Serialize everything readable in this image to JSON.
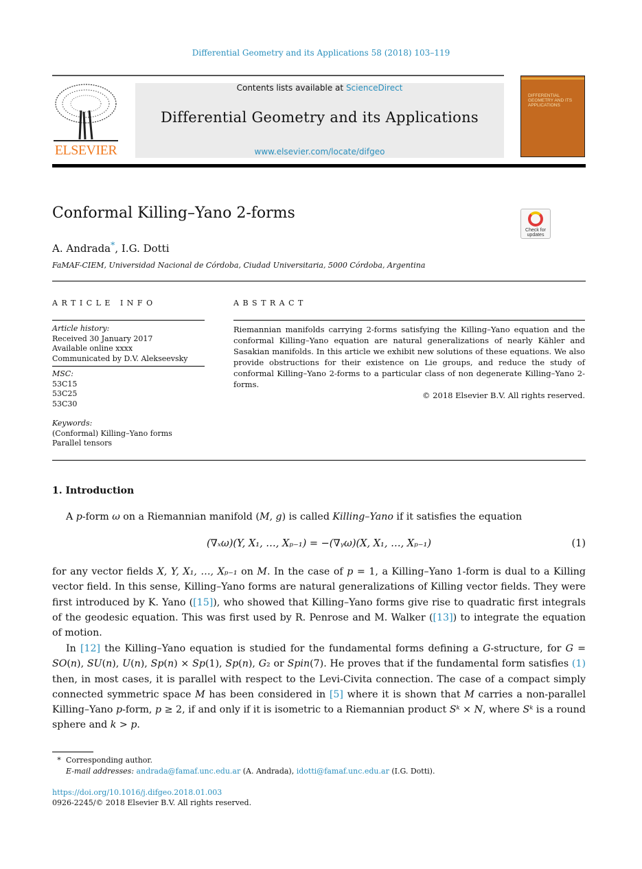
{
  "header": {
    "journal_ref": "Differential Geometry and its Applications 58 (2018) 103–119",
    "contents_prefix": "Contents lists available at ",
    "sciencedirect": "ScienceDirect",
    "journal_title": "Differential Geometry and its Applications",
    "journal_url": "www.elsevier.com/locate/difgeo",
    "publisher_logo": "ELSEVIER",
    "cover_title": "DIFFERENTIAL GEOMETRY AND ITS APPLICATIONS",
    "check_updates": "Check for updates"
  },
  "article": {
    "title": "Conformal Killing–Yano 2-forms",
    "author1": "A. Andrada",
    "author_mark": "*",
    "author_sep": ", ",
    "author2": "I.G. Dotti",
    "affiliation": "FaMAF-CIEM, Universidad Nacional de Córdoba, Ciudad Universitaria, 5000 Córdoba, Argentina"
  },
  "info": {
    "heading": "ARTICLE INFO",
    "history_label": "Article history:",
    "history": [
      "Received 30 January 2017",
      "Available online xxxx",
      "Communicated by D.V. Alekseevsky"
    ],
    "msc_label": "MSC:",
    "msc": [
      "53C15",
      "53C25",
      "53C30"
    ],
    "keywords_label": "Keywords:",
    "keywords": [
      "(Conformal) Killing–Yano forms",
      "Parallel tensors"
    ]
  },
  "abstract": {
    "heading": "ABSTRACT",
    "text": "Riemannian manifolds carrying 2-forms satisfying the Killing–Yano equation and the conformal Killing–Yano equation are natural generalizations of nearly Kähler and Sasakian manifolds. In this article we exhibit new solutions of these equations. We also provide obstructions for their existence on Lie groups, and reduce the study of conformal Killing–Yano 2-forms to a particular class of non degenerate Killing–Yano 2-forms.",
    "copyright": "© 2018 Elsevier B.V. All rights reserved."
  },
  "section1": {
    "heading": "1. Introduction",
    "p1": [
      {
        "t": "A "
      },
      {
        "t": "p",
        "s": "i"
      },
      {
        "t": "-form "
      },
      {
        "t": "ω",
        "s": "i"
      },
      {
        "t": " on a Riemannian manifold ("
      },
      {
        "t": "M, g",
        "s": "i"
      },
      {
        "t": ") is called "
      },
      {
        "t": "Killing–Yano",
        "s": "i"
      },
      {
        "t": " if it satisfies the equation"
      }
    ],
    "equation": "(∇ₓω)(Y, X₁, …, Xₚ₋₁) = −(∇ᵧω)(X, X₁, …, Xₚ₋₁)",
    "equation_number": "(1)",
    "p2": [
      {
        "t": "for any vector fields "
      },
      {
        "t": "X, Y, X₁, …, Xₚ₋₁",
        "s": "i"
      },
      {
        "t": " on "
      },
      {
        "t": "M",
        "s": "i"
      },
      {
        "t": ". In the case of "
      },
      {
        "t": "p",
        "s": "i"
      },
      {
        "t": " = 1, a Killing–Yano 1-form is dual to a Killing vector field. In this sense, Killing–Yano forms are natural generalizations of Killing vector fields. They were first introduced by K. Yano ("
      },
      {
        "t": "[15]",
        "s": "link"
      },
      {
        "t": "), who showed that Killing–Yano forms give rise to quadratic first integrals of the geodesic equation. This was first used by R. Penrose and M. Walker ("
      },
      {
        "t": "[13]",
        "s": "link"
      },
      {
        "t": ") to integrate the equation of motion."
      }
    ],
    "p3": [
      {
        "t": "In "
      },
      {
        "t": "[12]",
        "s": "link"
      },
      {
        "t": " the Killing–Yano equation is studied for the fundamental forms defining a "
      },
      {
        "t": "G",
        "s": "i"
      },
      {
        "t": "-structure, for "
      },
      {
        "t": "G",
        "s": "i"
      },
      {
        "t": " = "
      },
      {
        "t": "SO",
        "s": "i"
      },
      {
        "t": "("
      },
      {
        "t": "n",
        "s": "i"
      },
      {
        "t": "), "
      },
      {
        "t": "SU",
        "s": "i"
      },
      {
        "t": "("
      },
      {
        "t": "n",
        "s": "i"
      },
      {
        "t": "), "
      },
      {
        "t": "U",
        "s": "i"
      },
      {
        "t": "("
      },
      {
        "t": "n",
        "s": "i"
      },
      {
        "t": "), "
      },
      {
        "t": "Sp",
        "s": "i"
      },
      {
        "t": "("
      },
      {
        "t": "n",
        "s": "i"
      },
      {
        "t": ") × "
      },
      {
        "t": "Sp",
        "s": "i"
      },
      {
        "t": "(1), "
      },
      {
        "t": "Sp",
        "s": "i"
      },
      {
        "t": "("
      },
      {
        "t": "n",
        "s": "i"
      },
      {
        "t": "), "
      },
      {
        "t": "G",
        "s": "i"
      },
      {
        "t": "₂ or "
      },
      {
        "t": "Spin",
        "s": "i"
      },
      {
        "t": "(7). He proves that if the fundamental form satisfies "
      },
      {
        "t": "(1)",
        "s": "link"
      },
      {
        "t": " then, in most cases, it is parallel with respect to the Levi-Civita connection. The case of a compact simply connected symmetric space "
      },
      {
        "t": "M",
        "s": "i"
      },
      {
        "t": " has been considered in "
      },
      {
        "t": "[5]",
        "s": "link"
      },
      {
        "t": " where it is shown that "
      },
      {
        "t": "M",
        "s": "i"
      },
      {
        "t": " carries a non-parallel Killing–Yano "
      },
      {
        "t": "p",
        "s": "i"
      },
      {
        "t": "-form, "
      },
      {
        "t": "p",
        "s": "i"
      },
      {
        "t": " ≥ 2, if and only if it is isometric to a Riemannian product "
      },
      {
        "t": "Sᵏ",
        "s": "i"
      },
      {
        "t": " × "
      },
      {
        "t": "N",
        "s": "i"
      },
      {
        "t": ", where "
      },
      {
        "t": "Sᵏ",
        "s": "i"
      },
      {
        "t": " is a round sphere and "
      },
      {
        "t": "k",
        "s": "i"
      },
      {
        "t": " > "
      },
      {
        "t": "p",
        "s": "i"
      },
      {
        "t": "."
      }
    ]
  },
  "footnotes": {
    "mark": "*",
    "corresponding": "Corresponding author.",
    "email_label": "E-mail addresses:",
    "email1": "andrada@famaf.unc.edu.ar",
    "email1_name": " (A. Andrada), ",
    "email2": "idotti@famaf.unc.edu.ar",
    "email2_name": " (I.G. Dotti).",
    "doi": "https://doi.org/10.1016/j.difgeo.2018.01.003",
    "issn": "0926-2245/© 2018 Elsevier B.V. All rights reserved."
  },
  "colors": {
    "link": "#2a8fbd",
    "elsevier_orange": "#f07a20",
    "cover": "#c46a20",
    "banner": "#ebebeb"
  }
}
